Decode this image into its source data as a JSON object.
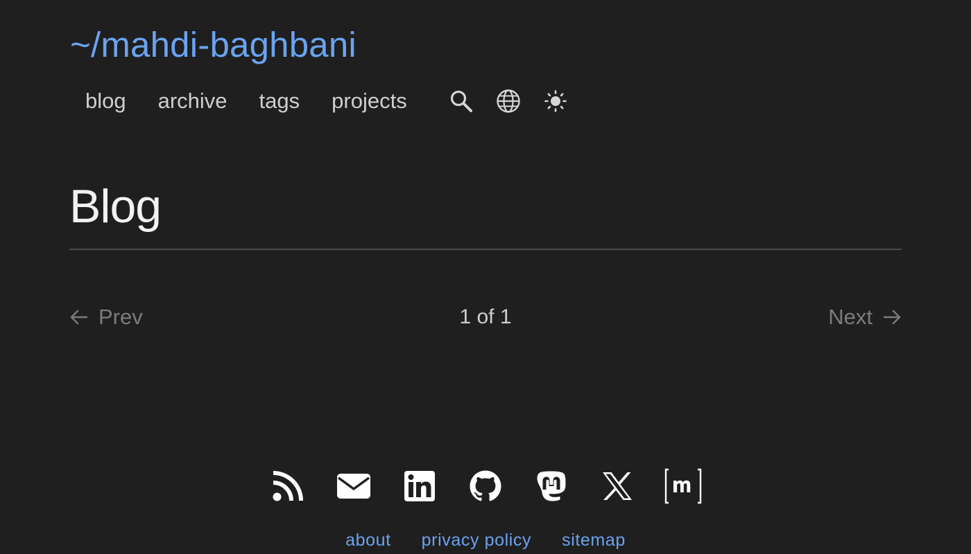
{
  "site": {
    "title": "~/mahdi-baghbani"
  },
  "nav": {
    "items": [
      {
        "label": "blog"
      },
      {
        "label": "archive"
      },
      {
        "label": "tags"
      },
      {
        "label": "projects"
      }
    ],
    "icons": [
      "search-icon",
      "globe-icon",
      "sun-icon"
    ]
  },
  "main": {
    "title": "Blog",
    "pagination": {
      "prev_label": "Prev",
      "next_label": "Next",
      "page_info": "1 of 1",
      "current_page": 1,
      "total_pages": 1
    }
  },
  "footer": {
    "social_icons": [
      "rss-icon",
      "email-icon",
      "linkedin-icon",
      "github-icon",
      "mastodon-icon",
      "x-icon",
      "matrix-icon"
    ],
    "links": [
      {
        "label": "about"
      },
      {
        "label": "privacy policy"
      },
      {
        "label": "sitemap"
      }
    ]
  },
  "colors": {
    "background": "#1f1f1f",
    "accent": "#6aa3f0",
    "text": "#dcdcdc",
    "muted": "#7c7c7c",
    "divider": "#4a4a4a"
  }
}
